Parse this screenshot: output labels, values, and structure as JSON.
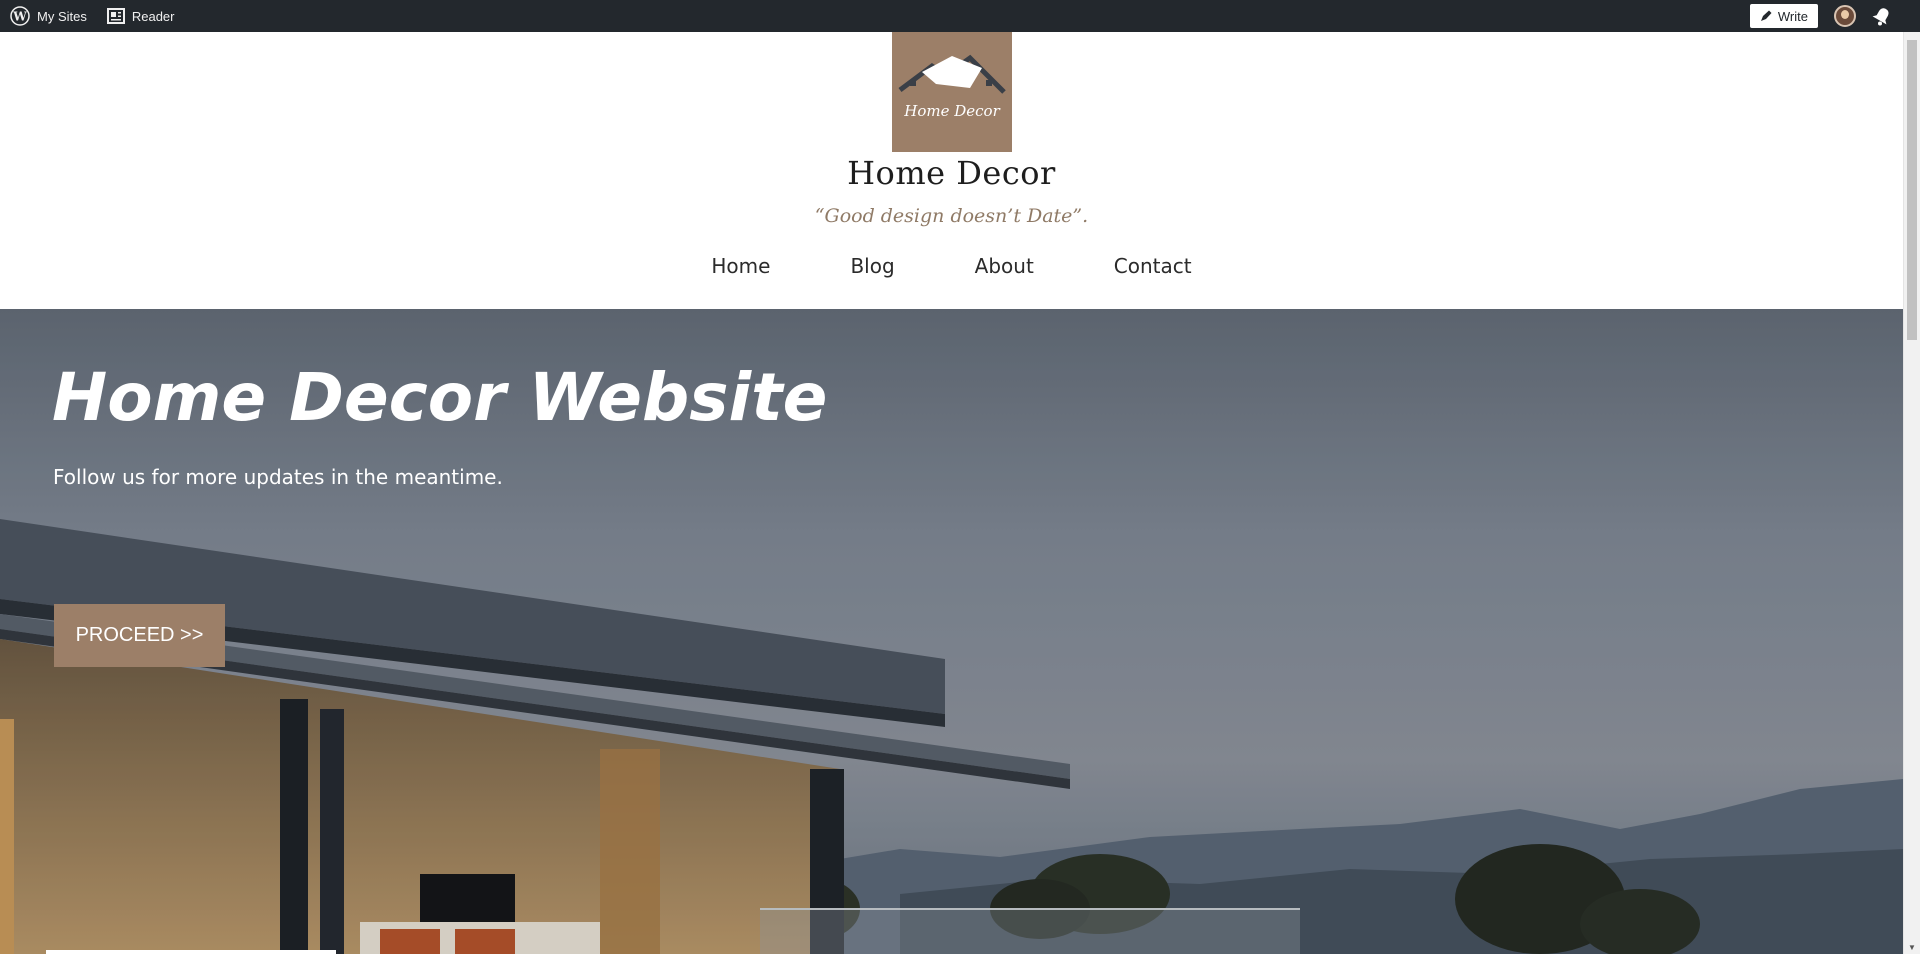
{
  "adminbar": {
    "my_sites": "My Sites",
    "reader": "Reader",
    "write": "Write"
  },
  "header": {
    "logo_text": "Home Decor",
    "site_title": "Home Decor",
    "tagline": "“Good design doesn’t Date”.",
    "nav": [
      "Home",
      "Blog",
      "About",
      "Contact"
    ]
  },
  "hero": {
    "title": "Home Decor Website",
    "subtitle": "Follow us for more updates in the meantime.",
    "button": "PROCEED >>"
  },
  "colors": {
    "adminbar": "#23282d",
    "brand": "#9c7f68",
    "tagline": "#8f7a66"
  },
  "icons": [
    "wordpress-icon",
    "reader-icon",
    "pen-icon",
    "avatar",
    "bell-icon"
  ]
}
